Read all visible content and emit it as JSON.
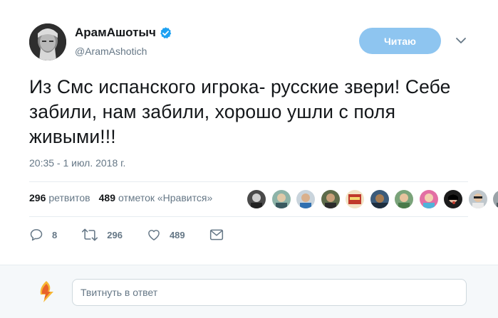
{
  "tweet": {
    "display_name": "АрамАшотыч",
    "handle": "@AramAshotich",
    "follow_label": "Читаю",
    "text": "Из Смс испанского игрока- русские звери! Себе забили, нам забили, хорошо ушли с поля живыми!!!",
    "timestamp": "20:35 - 1 июл. 2018 г."
  },
  "stats": {
    "retweets_count": "296",
    "retweets_label": "ретвитов",
    "likes_count": "489",
    "likes_label": "отметок «Нравится»"
  },
  "actions": {
    "replies": "8",
    "retweets": "296",
    "likes": "489"
  },
  "reply": {
    "placeholder": "Твитнуть в ответ"
  },
  "colors": {
    "accent": "#1da1f2",
    "follow_button": "#8ec5f0",
    "muted_text": "#657786"
  }
}
